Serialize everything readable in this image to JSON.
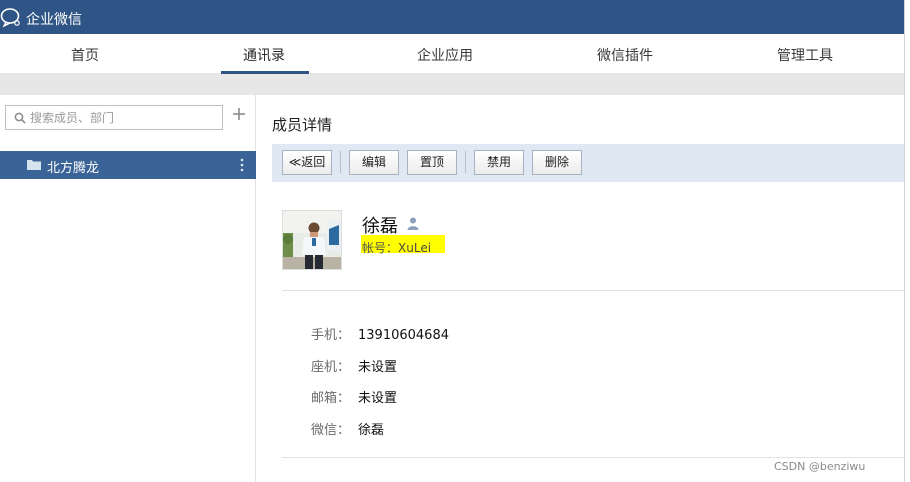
{
  "app": {
    "title": "企业微信"
  },
  "nav": {
    "items": [
      "首页",
      "通讯录",
      "企业应用",
      "微信插件",
      "管理工具"
    ],
    "active_index": 1
  },
  "sidebar": {
    "search_placeholder": "搜索成员、部门",
    "department": "北方腾龙"
  },
  "main": {
    "section_title": "成员详情",
    "toolbar": {
      "back": "≪返回",
      "edit": "编辑",
      "pin": "置顶",
      "disable": "禁用",
      "delete": "删除"
    },
    "member": {
      "name": "徐磊",
      "account_label": "帐号：",
      "account_value": "XuLei",
      "fields": [
        {
          "label": "手机：",
          "value": "13910604684"
        },
        {
          "label": "座机：",
          "value": "未设置"
        },
        {
          "label": "邮箱：",
          "value": "未设置"
        },
        {
          "label": "微信：",
          "value": "徐磊"
        }
      ]
    }
  },
  "watermark": "CSDN @benziwu",
  "colors": {
    "header_bg": "#2e5585",
    "selected_dept_bg": "#3a6497",
    "toolbar_bg": "#e0e9f3",
    "highlight": "#ffff00"
  },
  "icons": [
    "wechat-work-logo-icon",
    "search-icon",
    "plus-icon",
    "folder-icon",
    "more-vertical-icon",
    "person-icon"
  ]
}
